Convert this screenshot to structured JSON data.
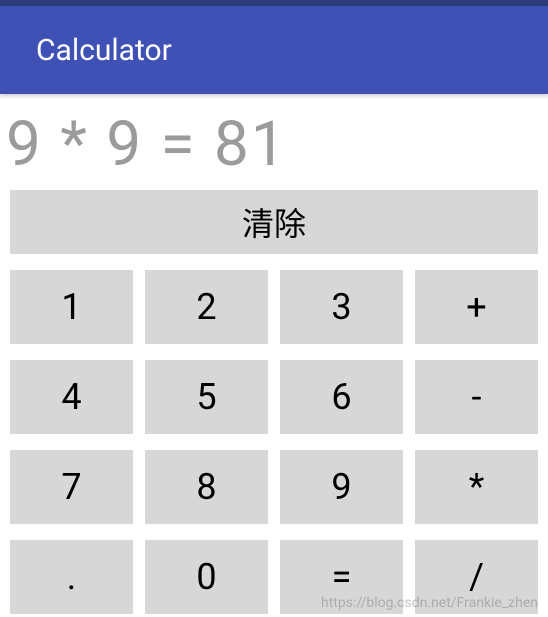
{
  "header": {
    "title": "Calculator"
  },
  "display": {
    "expression": "9 * 9 = 81"
  },
  "buttons": {
    "clear": "清除",
    "grid": [
      [
        "1",
        "2",
        "3",
        "+"
      ],
      [
        "4",
        "5",
        "6",
        "-"
      ],
      [
        "7",
        "8",
        "9",
        "*"
      ],
      [
        ".",
        "0",
        "=",
        "/"
      ]
    ]
  },
  "watermark": "https://blog.csdn.net/Frankie_zhen"
}
